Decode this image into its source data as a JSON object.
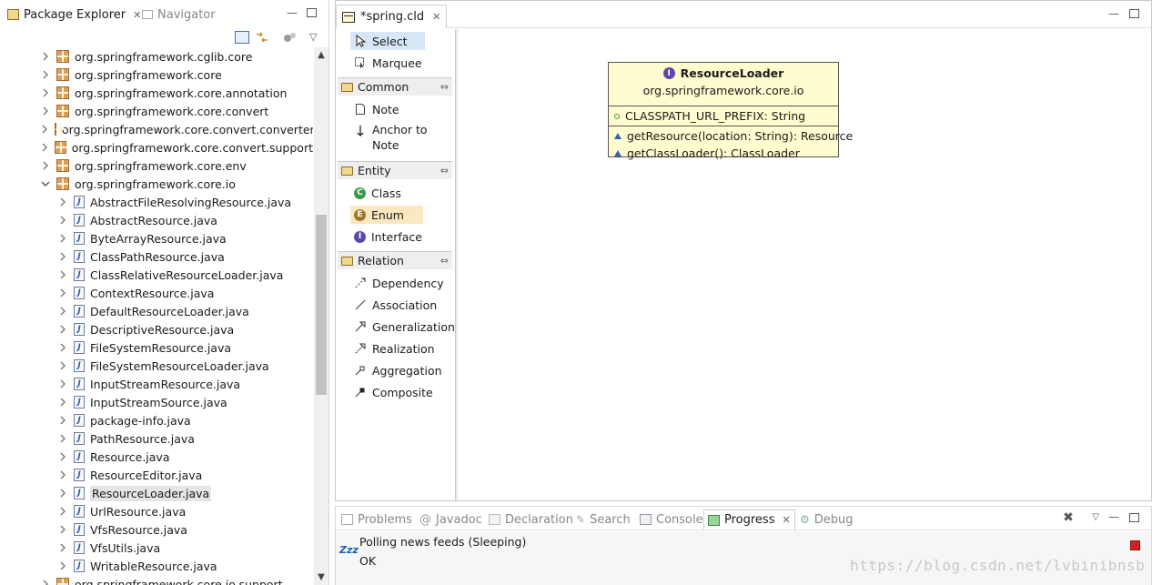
{
  "left_view": {
    "tabs": [
      {
        "label": "Package Explorer",
        "close": "✕"
      },
      {
        "label": "Navigator"
      }
    ],
    "scroll": {
      "up": "▲",
      "down": "▼"
    },
    "tree": [
      {
        "label": "org.springframework.cglib.core",
        "kind": "package",
        "expanded": false
      },
      {
        "label": "org.springframework.core",
        "kind": "package",
        "expanded": false
      },
      {
        "label": "org.springframework.core.annotation",
        "kind": "package",
        "expanded": false
      },
      {
        "label": "org.springframework.core.convert",
        "kind": "package",
        "expanded": false
      },
      {
        "label": "org.springframework.core.convert.converter",
        "kind": "package",
        "expanded": false
      },
      {
        "label": "org.springframework.core.convert.support",
        "kind": "package",
        "expanded": false
      },
      {
        "label": "org.springframework.core.env",
        "kind": "package",
        "expanded": false
      },
      {
        "label": "org.springframework.core.io",
        "kind": "package",
        "expanded": true
      },
      {
        "label": "AbstractFileResolvingResource.java",
        "kind": "java"
      },
      {
        "label": "AbstractResource.java",
        "kind": "java"
      },
      {
        "label": "ByteArrayResource.java",
        "kind": "java"
      },
      {
        "label": "ClassPathResource.java",
        "kind": "java"
      },
      {
        "label": "ClassRelativeResourceLoader.java",
        "kind": "java"
      },
      {
        "label": "ContextResource.java",
        "kind": "java"
      },
      {
        "label": "DefaultResourceLoader.java",
        "kind": "java"
      },
      {
        "label": "DescriptiveResource.java",
        "kind": "java"
      },
      {
        "label": "FileSystemResource.java",
        "kind": "java"
      },
      {
        "label": "FileSystemResourceLoader.java",
        "kind": "java"
      },
      {
        "label": "InputStreamResource.java",
        "kind": "java"
      },
      {
        "label": "InputStreamSource.java",
        "kind": "java"
      },
      {
        "label": "package-info.java",
        "kind": "java"
      },
      {
        "label": "PathResource.java",
        "kind": "java"
      },
      {
        "label": "Resource.java",
        "kind": "java"
      },
      {
        "label": "ResourceEditor.java",
        "kind": "java"
      },
      {
        "label": "ResourceLoader.java",
        "kind": "java",
        "selected": true
      },
      {
        "label": "UrlResource.java",
        "kind": "java"
      },
      {
        "label": "VfsResource.java",
        "kind": "java"
      },
      {
        "label": "VfsUtils.java",
        "kind": "java"
      },
      {
        "label": "WritableResource.java",
        "kind": "java"
      },
      {
        "label": "org.springframework.core.io.support",
        "kind": "package",
        "expanded": false
      }
    ]
  },
  "editor": {
    "tab_label": "*spring.cld",
    "tab_close": "✕",
    "palette": {
      "tools": [
        {
          "label": "Select",
          "icon": "arrow-cursor-icon"
        },
        {
          "label": "Marquee",
          "icon": "marquee-icon"
        }
      ],
      "drawers": [
        {
          "label": "Common",
          "items": [
            {
              "label": "Note",
              "icon": "note-icon"
            },
            {
              "label": "Anchor to Note",
              "icon": "anchor-arrow-icon"
            }
          ]
        },
        {
          "label": "Entity",
          "items": [
            {
              "label": "Class",
              "icon": "class-icon",
              "glyph": "C",
              "color": "#3a9a4a"
            },
            {
              "label": "Enum",
              "icon": "enum-icon",
              "glyph": "E",
              "color": "#a0792c"
            },
            {
              "label": "Interface",
              "icon": "interface-icon",
              "glyph": "I",
              "color": "#5b4aa8"
            }
          ]
        },
        {
          "label": "Relation",
          "items": [
            {
              "label": "Dependency",
              "icon": "dependency-icon"
            },
            {
              "label": "Association",
              "icon": "association-icon"
            },
            {
              "label": "Generalization",
              "icon": "generalization-icon"
            },
            {
              "label": "Realization",
              "icon": "realization-icon"
            },
            {
              "label": "Aggregation",
              "icon": "aggregation-icon"
            },
            {
              "label": "Composite",
              "icon": "composite-icon"
            }
          ]
        }
      ],
      "drawer_toggle": "⇔"
    },
    "uml": {
      "name": "ResourceLoader",
      "stereotype_glyph": "I",
      "package": "org.springframework.core.io",
      "fields": [
        "CLASSPATH_URL_PREFIX: String"
      ],
      "methods": [
        "getResource(location: String): Resource",
        "getClassLoader(): ClassLoader"
      ]
    }
  },
  "bottom_view": {
    "tabs": [
      {
        "label": "Problems",
        "icon": "problems-icon"
      },
      {
        "label": "Javadoc",
        "icon": "javadoc-icon"
      },
      {
        "label": "Declaration",
        "icon": "declaration-icon"
      },
      {
        "label": "Search",
        "icon": "search-icon"
      },
      {
        "label": "Console",
        "icon": "console-icon"
      },
      {
        "label": "Progress",
        "icon": "progress-icon",
        "active": true,
        "close": "✕"
      },
      {
        "label": "Debug",
        "icon": "debug-icon"
      }
    ],
    "progress": {
      "sleep_glyph": "Zzz",
      "job": "Polling news feeds (Sleeping)",
      "status": "OK"
    }
  },
  "watermark": "https://blog.csdn.net/lvbinibnsb"
}
